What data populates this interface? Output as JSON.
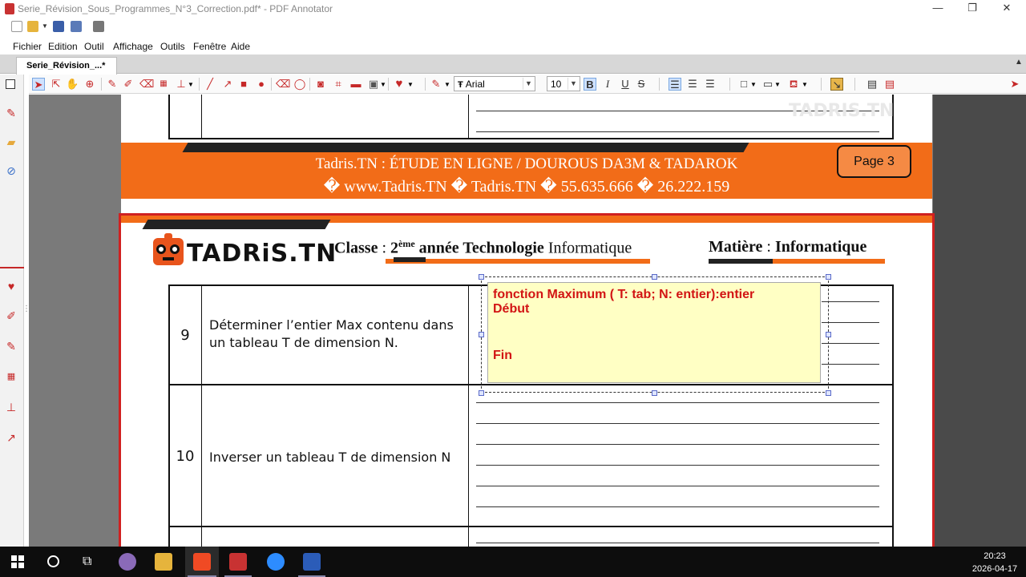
{
  "window": {
    "title": "Serie_Révision_Sous_Programmes_N°3_Correction.pdf* - PDF Annotator",
    "controls": {
      "minimize": "—",
      "restore": "❐",
      "close": "✕"
    }
  },
  "menu": [
    "Fichier",
    "Edition",
    "Outil",
    "Affichage",
    "Outils",
    "Fenêtre",
    "Aide"
  ],
  "tab": {
    "label": "Serie_Révision_...*"
  },
  "toolbar": {
    "font": "Arial",
    "font_size": "10",
    "bold": "B",
    "italic": "I",
    "underline": "U",
    "strike": "S"
  },
  "document": {
    "watermark": "TADRIS.TN",
    "footer": {
      "line1": "Tadris.TN : ÉTUDE EN LIGNE / DOUROUS DA3M & TADAROK",
      "line2": "� www.Tadris.TN   �  Tadris.TN   � 55.635.666 � 26.222.159",
      "page_label": "Page  3"
    },
    "header": {
      "logo": "TADRiS.TN",
      "classe_label": "Classe",
      "classe_sep": " : ",
      "classe_num": "2",
      "classe_sup": "ème",
      "classe_annee": " année ",
      "classe_tech": "Technologie",
      "classe_info": " Informatique",
      "matiere_label": "Matière",
      "matiere_sep": " : ",
      "matiere_value": "Informatique"
    },
    "rows": [
      {
        "num": "9",
        "text": "Déterminer l’entier Max contenu dans un tableau T de dimension N."
      },
      {
        "num": "10",
        "text": "Inverser un tableau T de dimension N"
      }
    ],
    "annotation": {
      "line1": "fonction Maximum ( T: tab; N: entier):entier",
      "line2": "Début",
      "line3": "Fin"
    }
  },
  "taskbar": {
    "time": "20:23",
    "date": "2026-04-17"
  }
}
